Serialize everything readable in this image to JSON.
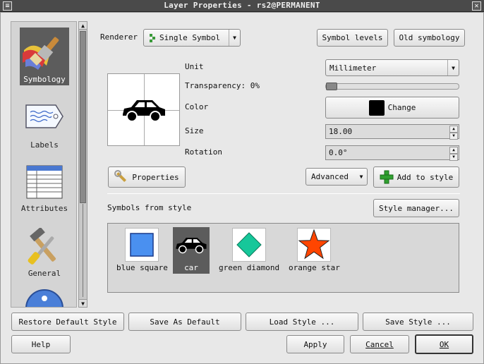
{
  "window": {
    "title": "Layer Properties - rs2@PERMANENT",
    "menu_glyph": "≡",
    "close_glyph": "✕"
  },
  "sidebar": {
    "items": [
      {
        "label": "Symbology",
        "icon": "paintbrush-icon",
        "selected": true
      },
      {
        "label": "Labels",
        "icon": "label-tag-icon",
        "selected": false
      },
      {
        "label": "Attributes",
        "icon": "table-icon",
        "selected": false
      },
      {
        "label": "General",
        "icon": "tools-icon",
        "selected": false
      },
      {
        "label": "",
        "icon": "info-icon",
        "selected": false
      }
    ]
  },
  "renderer": {
    "label": "Renderer",
    "selected": "Single Symbol"
  },
  "symbol_levels_label": "Symbol levels",
  "old_symbology_label": "Old symbology",
  "unit": {
    "label": "Unit",
    "value": "Millimeter"
  },
  "transparency": {
    "label": "Transparency: 0%",
    "value": 0
  },
  "color": {
    "label": "Color",
    "button_label": "Change",
    "swatch": "#000000"
  },
  "size": {
    "label": "Size",
    "value": "18.00"
  },
  "rotation": {
    "label": "Rotation",
    "value": "0.0°"
  },
  "properties_label": "Properties",
  "advanced_label": "Advanced",
  "add_to_style_label": "Add to style",
  "symbols_from_style_label": "Symbols from style",
  "style_manager_label": "Style manager...",
  "symbols": [
    {
      "name": "blue square",
      "color": "#4a90f0",
      "selected": false
    },
    {
      "name": "car",
      "color": "#000000",
      "selected": true
    },
    {
      "name": "green diamond",
      "color": "#16c79a",
      "selected": false
    },
    {
      "name": "orange star",
      "color": "#ff4500",
      "selected": false
    }
  ],
  "bottom": {
    "restore_default": "Restore Default Style",
    "save_as_default": "Save As Default",
    "load_style": "Load Style ...",
    "save_style": "Save Style ...",
    "help": "Help",
    "apply": "Apply",
    "cancel": "Cancel",
    "ok": "OK"
  }
}
